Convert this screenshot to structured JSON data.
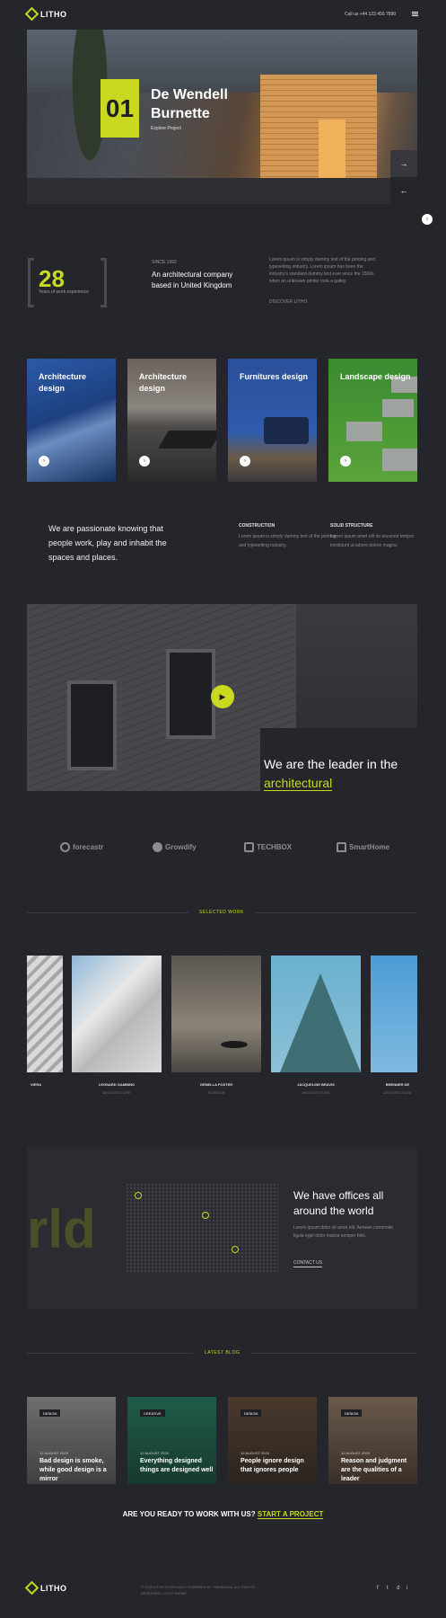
{
  "header": {
    "logo": "LITHO",
    "phone": "Call us +44 123 456 7890"
  },
  "hero": {
    "number": "01",
    "title": "De Wendell Burnette",
    "link": "Explore Project",
    "next_label": "→",
    "prev_label": "←"
  },
  "stats": {
    "years": "28",
    "years_label": "Years of work experience",
    "since": "SINCE 1992",
    "about_title": "An architectural company based in United Kingdom",
    "about_body": "Lorem ipsum is simply dummy text of the printing and typesetting industry. Lorem ipsum has been the industry's standard dummy text ever since the 1500s when an unknown printer took a galley.",
    "about_link": "DISCOVER LITHO"
  },
  "services": [
    {
      "title": "Architecture design",
      "color": "#2c5aa8"
    },
    {
      "title": "Architecture design",
      "color": "#6b625a"
    },
    {
      "title": "Furnitures design",
      "color": "#2b4f9a"
    },
    {
      "title": "Landscape design",
      "color": "#3a8a30"
    }
  ],
  "passion": {
    "text": "We are passionate knowing that people work, play and inhabit the spaces and places.",
    "col1_heading": "CONSTRUCTION",
    "col1_body": "Lorem ipsum is simply dummy text of the printing and typesetting industry.",
    "col2_heading": "SOLID STRUCTURE",
    "col2_body": "Lorem ipsum amet elit do eiusmod tempor incididunt ut labore dolore magna."
  },
  "video": {
    "play_label": "▶",
    "leader_text": "We are the leader in the",
    "leader_highlight": "architectural"
  },
  "clients": [
    "forecastr",
    "Growdify",
    "TECHBOX",
    "SmartHome"
  ],
  "selected_work": {
    "label": "SELECTED WORK",
    "items": [
      {
        "title": "VIERA",
        "sub": "·"
      },
      {
        "title": "LEONARD GAMBINO",
        "sub": "ARCHITECTURE"
      },
      {
        "title": "GENELLA FOSTER",
        "sub": "INTERIOR"
      },
      {
        "title": "JACQUELINE BRAVIS",
        "sub": "ARCHITECTURE"
      },
      {
        "title": "BRENNER DE",
        "sub": "ARCHITECTURE"
      }
    ]
  },
  "offices": {
    "big_text": "rld",
    "title": "We have offices all around the world",
    "body": "Lorem ipsum dolor sit amet elit. Aenean commodo ligula eget dolor massa semper felis.",
    "link": "CONTACT US"
  },
  "latest_blog": {
    "label": "LATEST BLOG",
    "posts": [
      {
        "category": "DESIGN",
        "date": "12 AUGUST 2020",
        "title": "Bad design is smoke, while good design is a mirror"
      },
      {
        "category": "CREATIVE",
        "date": "12 AUGUST 2020",
        "title": "Everything designed things are designed well"
      },
      {
        "category": "DESIGN",
        "date": "12 AUGUST 2020",
        "title": "People ignore design that ignores people"
      },
      {
        "category": "DESIGN",
        "date": "12 AUGUST 2020",
        "title": "Reason and judgment are the qualities of a leader"
      }
    ]
  },
  "cta": {
    "question": "ARE YOU READY TO WORK WITH US?",
    "link": "START A PROJECT"
  },
  "footer": {
    "logo": "LITHO",
    "text": "© 2020 LITHO IS PROUDLY POWERED BY THEMEZAA. ALL RIGHTS RESERVED. LITHO THEME.",
    "social": [
      "f",
      "t",
      "d",
      "i"
    ]
  }
}
